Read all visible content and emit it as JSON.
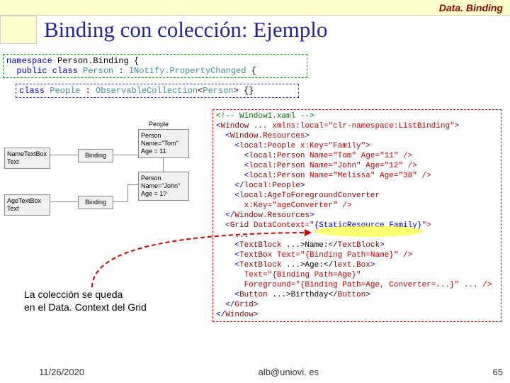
{
  "header": {
    "breadcrumb": "Data. Binding"
  },
  "title": "Binding con colección: Ejemplo",
  "codeA_l1a": "namespace ",
  "codeA_l1b": "Person.Binding {",
  "codeA_l2a": "  public class ",
  "codeA_l2b": "Person",
  "codeA_l2c": " : ",
  "codeA_l2d": "INotify.PropertyChanged",
  "codeA_l2e": " {",
  "codeB_l1a": "class ",
  "codeB_l1b": "People",
  "codeB_l1c": " : ",
  "codeB_l1d": "ObservableCollection",
  "codeB_l1e": "<",
  "codeB_l1f": "Person",
  "codeB_l1g": "> {}",
  "xaml_l1": "<!-- Window1.xaml -->",
  "xaml_l2a": "<",
  "xaml_l2b": "Window ",
  "xaml_l2c": "... xmlns:local=\"clr-namespace:ListBinding\">",
  "xaml_l3a": "  <",
  "xaml_l3b": "Window.Resources",
  "xaml_l3c": ">",
  "xaml_l4a": "    <",
  "xaml_l4b": "local:People",
  "xaml_l4c": " x:Key=\"Family\">",
  "xaml_l5a": "      <",
  "xaml_l5b": "local:Person",
  "xaml_l5c": " Name=\"Tom\" Age=\"11\" />",
  "xaml_l6a": "      <",
  "xaml_l6b": "local:Person",
  "xaml_l6c": " Name=\"John\" Age=\"12\" />",
  "xaml_l7a": "      <",
  "xaml_l7b": "local:Person",
  "xaml_l7c": " Name=\"Melissa\" Age=\"38\" />",
  "xaml_l8a": "    </",
  "xaml_l8b": "local:People",
  "xaml_l8c": ">",
  "xaml_l9a": "    <",
  "xaml_l9b": "local:AgeToForegroundConverter",
  "xaml_l10": "      x:Key=\"ageConverter\" />",
  "xaml_l11a": "  </",
  "xaml_l11b": "Window.Resources",
  "xaml_l11c": ">",
  "xaml_l12a": "  <",
  "xaml_l12b": "Grid",
  "xaml_l12c": " DataContext=\"",
  "xaml_l12d": "{StaticResource Family}",
  "xaml_l12e": "\">",
  "xaml_l13": "    ...",
  "xaml_l14a": "    <",
  "xaml_l14b": "TextBlock ",
  "xaml_l14c": "...>Name:</",
  "xaml_l14d": "TextBlock",
  "xaml_l14e": ">",
  "xaml_l15a": "    <",
  "xaml_l15b": "TextBox",
  "xaml_l15c": " Text=\"{Binding Path=Name}\" />",
  "xaml_l16a": "    <",
  "xaml_l16b": "TextBlock ",
  "xaml_l16c": "...>Age:</",
  "xaml_l16d": "lext.Box",
  "xaml_l16e": ">",
  "xaml_l17": "      Text=\"{Binding Path=Age}\"",
  "xaml_l18": "      Foreground=\"{Binding Path=Age, Converter=...}\" ... />",
  "xaml_l19a": "    <",
  "xaml_l19b": "Button ",
  "xaml_l19c": "...>Birthday</",
  "xaml_l19d": "Button",
  "xaml_l19e": ">",
  "xaml_l20a": "  </",
  "xaml_l20b": "Grid",
  "xaml_l20c": ">",
  "xaml_l21a": "</",
  "xaml_l21b": "Window",
  "xaml_l21c": ">",
  "diagram": {
    "nameTB": "NameTextBox\nText",
    "ageTB": "AgeTextBox\nText",
    "binding": "Binding",
    "peopleLabel": "People",
    "p1": "Person\nName=\"Tom\"\nAge = 11",
    "p2": "Person\nName=\"John\"\nAge = 1?"
  },
  "caption_l1": "La colección se queda",
  "caption_l2": "en el Data. Context del Grid",
  "footer": {
    "date": "11/26/2020",
    "email": "alb@uniovi. es",
    "page": "65"
  }
}
